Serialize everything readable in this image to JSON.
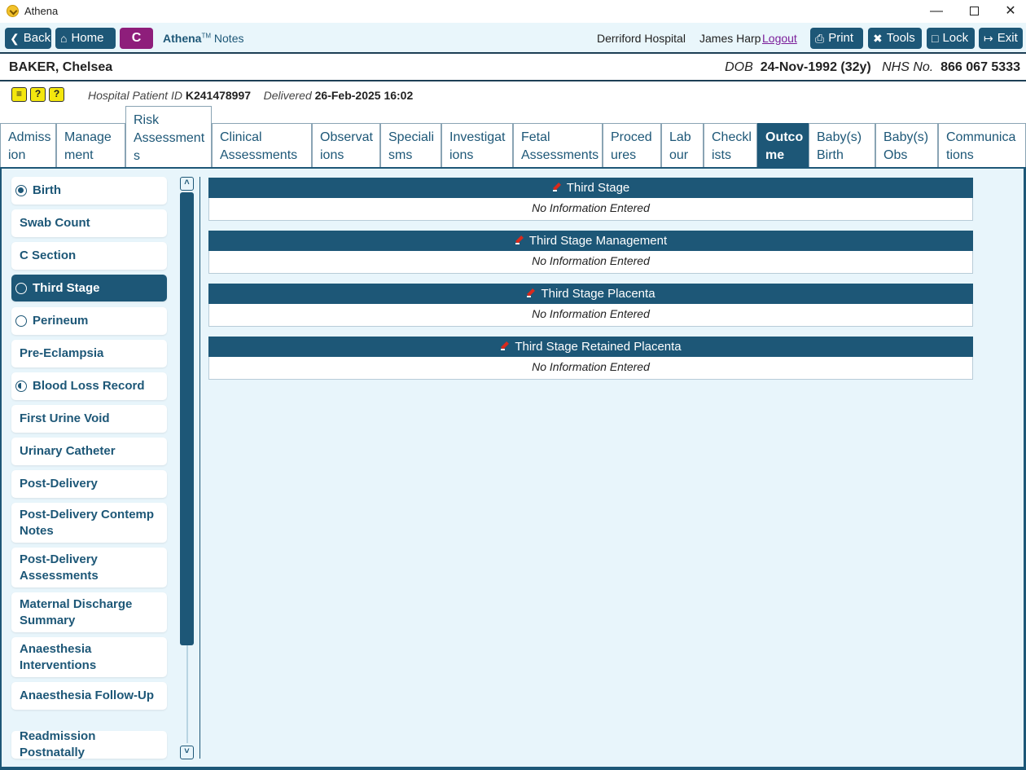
{
  "window": {
    "title": "Athena"
  },
  "toolbar": {
    "back": "Back",
    "home": "Home",
    "c_badge": "C",
    "brand_name": "Athena",
    "brand_tm": "TM",
    "brand_suffix": "Notes",
    "hospital": "Derriford Hospital",
    "user": "James Harp",
    "logout": "Logout",
    "print": "Print",
    "tools": "Tools",
    "lock": "Lock",
    "exit": "Exit"
  },
  "patient": {
    "name": "BAKER, Chelsea",
    "dob_label": "DOB",
    "dob": "24-Nov-1992 (32y)",
    "nhs_label": "NHS No.",
    "nhs": "866 067 5333",
    "hospital_id_label": "Hospital Patient ID",
    "hospital_id": "K241478997",
    "delivered_label": "Delivered",
    "delivered": "26-Feb-2025 16:02",
    "alert_icons": [
      "list-alert-icon",
      "question-icon",
      "question-icon"
    ]
  },
  "tabs": [
    {
      "l1": "Admiss",
      "l2": "ion"
    },
    {
      "l1": "Manage",
      "l2": "ment"
    },
    {
      "l1": "Risk",
      "l2": "Assessment",
      "l3": "s"
    },
    {
      "l1": "Clinical",
      "l2": "Assessments"
    },
    {
      "l1": "Observat",
      "l2": "ions"
    },
    {
      "l1": "Speciali",
      "l2": "sms"
    },
    {
      "l1": "Investigat",
      "l2": "ions"
    },
    {
      "l1": "Fetal",
      "l2": "Assessments"
    },
    {
      "l1": "Proced",
      "l2": "ures"
    },
    {
      "l1": "Lab",
      "l2": "our"
    },
    {
      "l1": "Checkl",
      "l2": "ists"
    },
    {
      "l1": "Outco",
      "l2": "me"
    },
    {
      "l1": "Baby(s)",
      "l2": "Birth"
    },
    {
      "l1": "Baby(s)",
      "l2": "Obs"
    },
    {
      "l1": "Communica",
      "l2": "tions"
    }
  ],
  "active_tab": "Outcome",
  "sidebar": {
    "items": [
      {
        "label": "Birth",
        "status": "complete"
      },
      {
        "label": "Swab Count"
      },
      {
        "label": "C Section"
      },
      {
        "label": "Third Stage",
        "status": "empty",
        "active": true
      },
      {
        "label": "Perineum",
        "status": "empty"
      },
      {
        "label": "Pre-Eclampsia"
      },
      {
        "label": "Blood Loss Record",
        "status": "partial"
      },
      {
        "label": "First Urine Void"
      },
      {
        "label": "Urinary Catheter"
      },
      {
        "label": "Post-Delivery"
      },
      {
        "label": "Post-Delivery Contemp Notes"
      },
      {
        "label": "Post-Delivery Assessments"
      },
      {
        "label": "Maternal Discharge Summary"
      },
      {
        "label": "Anaesthesia Interventions"
      },
      {
        "label": "Anaesthesia Follow-Up"
      },
      {
        "label": "Readmission Postnatally"
      }
    ]
  },
  "sections": [
    {
      "title": "Third Stage",
      "body": "No Information Entered"
    },
    {
      "title": "Third Stage Management",
      "body": "No Information Entered"
    },
    {
      "title": "Third Stage Placenta",
      "body": "No Information Entered"
    },
    {
      "title": "Third Stage Retained Placenta",
      "body": "No Information Entered"
    }
  ],
  "colors": {
    "primary": "#1d5777",
    "c_badge": "#8e1e7b",
    "panel_bg": "#e8f5fb",
    "toolbar_bg": "#e9f6fb",
    "alert_yellow": "#f4e70e",
    "logout_link": "#7b1e9a",
    "edit_icon_red": "#d92a1c"
  }
}
